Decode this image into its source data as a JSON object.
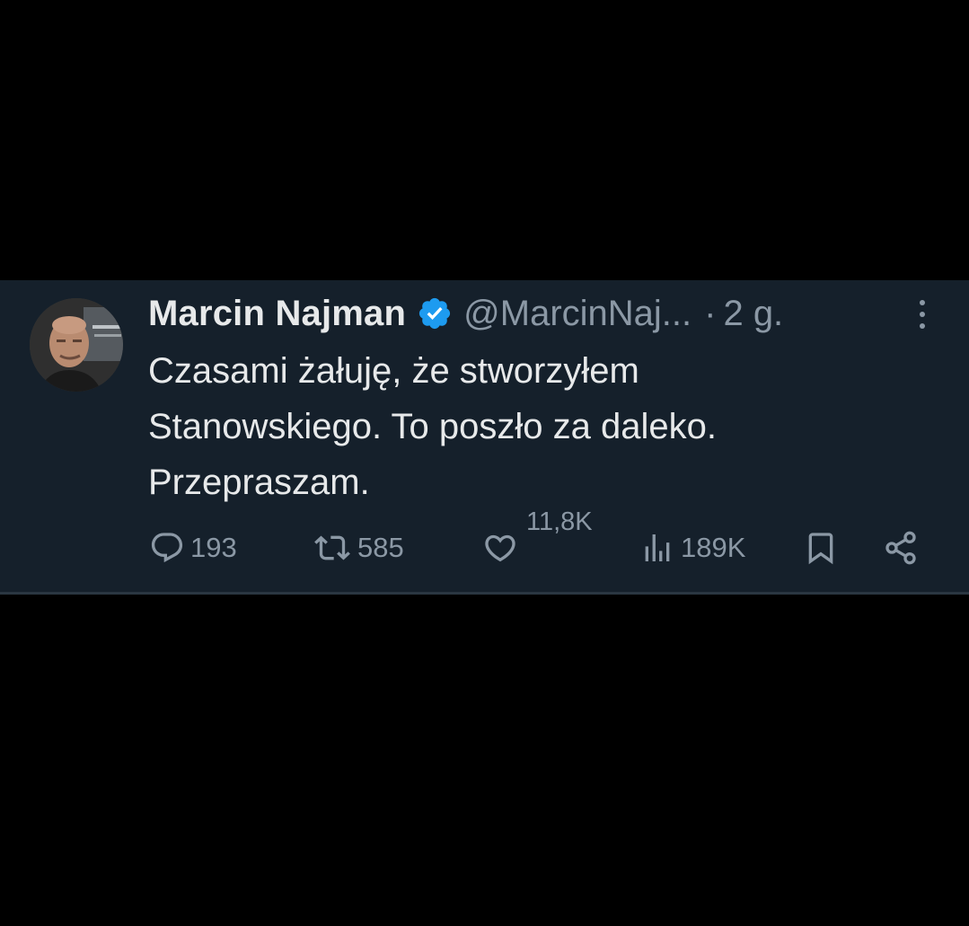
{
  "tweet": {
    "author_name": "Marcin Najman",
    "handle": "@MarcinNaj...",
    "separator": "·",
    "time": "2 g.",
    "text_lines": [
      "Czasami żałuję, że stworzyłem",
      "Stanowskiego. To poszło za daleko.",
      "Przepraszam."
    ],
    "verified_color": "#1d9bf0"
  },
  "actions": {
    "replies": "193",
    "retweets": "585",
    "likes": "11,8K",
    "views": "189K"
  },
  "icons": {
    "reply": "reply-icon",
    "retweet": "retweet-icon",
    "like": "heart-icon",
    "views": "views-icon",
    "bookmark": "bookmark-icon",
    "share": "share-icon",
    "more": "more-icon",
    "verified": "verified-badge-icon"
  },
  "colors": {
    "background": "#000000",
    "card": "#15202b",
    "text_primary": "#e7e9ea",
    "text_secondary": "#8b98a5"
  }
}
